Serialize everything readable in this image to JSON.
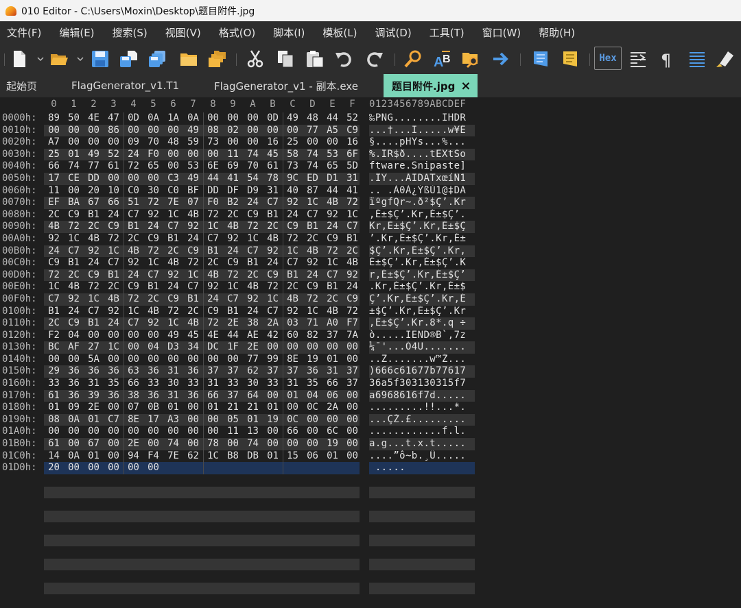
{
  "window": {
    "title": "010 Editor - C:\\Users\\Moxin\\Desktop\\题目附件.jpg"
  },
  "menu": [
    "文件(F)",
    "编辑(E)",
    "搜索(S)",
    "视图(V)",
    "格式(O)",
    "脚本(I)",
    "模板(L)",
    "调试(D)",
    "工具(T)",
    "窗口(W)",
    "帮助(H)"
  ],
  "toolbar": {
    "hex_label": "Hex",
    "colors": {
      "blue": "#4f9be8",
      "orange": "#f3a73a",
      "gray": "#d9d9d9",
      "yellow": "#f0c040"
    }
  },
  "tabs": [
    {
      "label": "起始页"
    },
    {
      "label": "FlagGenerator_v1.T1"
    },
    {
      "label": "FlagGenerator_v1 - 副本.exe"
    },
    {
      "label": "题目附件.jpg",
      "close": "×",
      "active": true
    }
  ],
  "hex_view": {
    "column_headers": [
      "0",
      "1",
      "2",
      "3",
      "4",
      "5",
      "6",
      "7",
      "8",
      "9",
      "A",
      "B",
      "C",
      "D",
      "E",
      "F"
    ],
    "ascii_header": "0123456789ABCDEF",
    "rows": [
      {
        "addr": "0000h:",
        "bytes": [
          "89",
          "50",
          "4E",
          "47",
          "0D",
          "0A",
          "1A",
          "0A",
          "00",
          "00",
          "00",
          "0D",
          "49",
          "48",
          "44",
          "52"
        ],
        "ascii": "‰PNG........IHDR"
      },
      {
        "addr": "0010h:",
        "bytes": [
          "00",
          "00",
          "00",
          "86",
          "00",
          "00",
          "00",
          "49",
          "08",
          "02",
          "00",
          "00",
          "00",
          "77",
          "A5",
          "C9"
        ],
        "ascii": "...†...I.....w¥É"
      },
      {
        "addr": "0020h:",
        "bytes": [
          "A7",
          "00",
          "00",
          "00",
          "09",
          "70",
          "48",
          "59",
          "73",
          "00",
          "00",
          "16",
          "25",
          "00",
          "00",
          "16"
        ],
        "ascii": "§....pHYs...%..."
      },
      {
        "addr": "0030h:",
        "bytes": [
          "25",
          "01",
          "49",
          "52",
          "24",
          "F0",
          "00",
          "00",
          "00",
          "11",
          "74",
          "45",
          "58",
          "74",
          "53",
          "6F"
        ],
        "ascii": "%.IR$ð....tEXtSo"
      },
      {
        "addr": "0040h:",
        "bytes": [
          "66",
          "74",
          "77",
          "61",
          "72",
          "65",
          "00",
          "53",
          "6E",
          "69",
          "70",
          "61",
          "73",
          "74",
          "65",
          "5D"
        ],
        "ascii": "ftware.Snipaste]"
      },
      {
        "addr": "0050h:",
        "bytes": [
          "17",
          "CE",
          "DD",
          "00",
          "00",
          "00",
          "C3",
          "49",
          "44",
          "41",
          "54",
          "78",
          "9C",
          "ED",
          "D1",
          "31"
        ],
        "ascii": ".ÎÝ...ÃIDATxœíÑ1"
      },
      {
        "addr": "0060h:",
        "bytes": [
          "11",
          "00",
          "20",
          "10",
          "C0",
          "30",
          "C0",
          "BF",
          "DD",
          "DF",
          "D9",
          "31",
          "40",
          "87",
          "44",
          "41"
        ],
        "ascii": ".. .À0À¿ÝßÙ1@‡DA"
      },
      {
        "addr": "0070h:",
        "bytes": [
          "EF",
          "BA",
          "67",
          "66",
          "51",
          "72",
          "7E",
          "07",
          "F0",
          "B2",
          "24",
          "C7",
          "92",
          "1C",
          "4B",
          "72"
        ],
        "ascii": "ïºgfQr~.ð²$Ç’.Kr"
      },
      {
        "addr": "0080h:",
        "bytes": [
          "2C",
          "C9",
          "B1",
          "24",
          "C7",
          "92",
          "1C",
          "4B",
          "72",
          "2C",
          "C9",
          "B1",
          "24",
          "C7",
          "92",
          "1C"
        ],
        "ascii": ",É±$Ç’.Kr,É±$Ç’."
      },
      {
        "addr": "0090h:",
        "bytes": [
          "4B",
          "72",
          "2C",
          "C9",
          "B1",
          "24",
          "C7",
          "92",
          "1C",
          "4B",
          "72",
          "2C",
          "C9",
          "B1",
          "24",
          "C7"
        ],
        "ascii": "Kr,É±$Ç’.Kr,É±$Ç"
      },
      {
        "addr": "00A0h:",
        "bytes": [
          "92",
          "1C",
          "4B",
          "72",
          "2C",
          "C9",
          "B1",
          "24",
          "C7",
          "92",
          "1C",
          "4B",
          "72",
          "2C",
          "C9",
          "B1"
        ],
        "ascii": "’.Kr,É±$Ç’.Kr,É±"
      },
      {
        "addr": "00B0h:",
        "bytes": [
          "24",
          "C7",
          "92",
          "1C",
          "4B",
          "72",
          "2C",
          "C9",
          "B1",
          "24",
          "C7",
          "92",
          "1C",
          "4B",
          "72",
          "2C"
        ],
        "ascii": "$Ç’.Kr,É±$Ç’.Kr,"
      },
      {
        "addr": "00C0h:",
        "bytes": [
          "C9",
          "B1",
          "24",
          "C7",
          "92",
          "1C",
          "4B",
          "72",
          "2C",
          "C9",
          "B1",
          "24",
          "C7",
          "92",
          "1C",
          "4B"
        ],
        "ascii": "É±$Ç’.Kr,É±$Ç’.K"
      },
      {
        "addr": "00D0h:",
        "bytes": [
          "72",
          "2C",
          "C9",
          "B1",
          "24",
          "C7",
          "92",
          "1C",
          "4B",
          "72",
          "2C",
          "C9",
          "B1",
          "24",
          "C7",
          "92"
        ],
        "ascii": "r,É±$Ç’.Kr,É±$Ç’"
      },
      {
        "addr": "00E0h:",
        "bytes": [
          "1C",
          "4B",
          "72",
          "2C",
          "C9",
          "B1",
          "24",
          "C7",
          "92",
          "1C",
          "4B",
          "72",
          "2C",
          "C9",
          "B1",
          "24"
        ],
        "ascii": ".Kr,É±$Ç’.Kr,É±$"
      },
      {
        "addr": "00F0h:",
        "bytes": [
          "C7",
          "92",
          "1C",
          "4B",
          "72",
          "2C",
          "C9",
          "B1",
          "24",
          "C7",
          "92",
          "1C",
          "4B",
          "72",
          "2C",
          "C9"
        ],
        "ascii": "Ç’.Kr,É±$Ç’.Kr,É"
      },
      {
        "addr": "0100h:",
        "bytes": [
          "B1",
          "24",
          "C7",
          "92",
          "1C",
          "4B",
          "72",
          "2C",
          "C9",
          "B1",
          "24",
          "C7",
          "92",
          "1C",
          "4B",
          "72"
        ],
        "ascii": "±$Ç’.Kr,É±$Ç’.Kr"
      },
      {
        "addr": "0110h:",
        "bytes": [
          "2C",
          "C9",
          "B1",
          "24",
          "C7",
          "92",
          "1C",
          "4B",
          "72",
          "2E",
          "38",
          "2A",
          "03",
          "71",
          "A0",
          "F7"
        ],
        "ascii": ",É±$Ç’.Kr.8*.q ÷"
      },
      {
        "addr": "0120h:",
        "bytes": [
          "F2",
          "04",
          "00",
          "00",
          "00",
          "00",
          "49",
          "45",
          "4E",
          "44",
          "AE",
          "42",
          "60",
          "82",
          "37",
          "7A"
        ],
        "ascii": "ò.....IEND®B`‚7z"
      },
      {
        "addr": "0130h:",
        "bytes": [
          "BC",
          "AF",
          "27",
          "1C",
          "00",
          "04",
          "D3",
          "34",
          "DC",
          "1F",
          "2E",
          "00",
          "00",
          "00",
          "00",
          "00"
        ],
        "ascii": "¼¯'...Ó4Ü......."
      },
      {
        "addr": "0140h:",
        "bytes": [
          "00",
          "00",
          "5A",
          "00",
          "00",
          "00",
          "00",
          "00",
          "00",
          "00",
          "77",
          "99",
          "8E",
          "19",
          "01",
          "00"
        ],
        "ascii": "..Z.......w™Ž..."
      },
      {
        "addr": "0150h:",
        "bytes": [
          "29",
          "36",
          "36",
          "36",
          "63",
          "36",
          "31",
          "36",
          "37",
          "37",
          "62",
          "37",
          "37",
          "36",
          "31",
          "37"
        ],
        "ascii": ")666c61677b77617"
      },
      {
        "addr": "0160h:",
        "bytes": [
          "33",
          "36",
          "31",
          "35",
          "66",
          "33",
          "30",
          "33",
          "31",
          "33",
          "30",
          "33",
          "31",
          "35",
          "66",
          "37"
        ],
        "ascii": "36a5f303130315f7"
      },
      {
        "addr": "0170h:",
        "bytes": [
          "61",
          "36",
          "39",
          "36",
          "38",
          "36",
          "31",
          "36",
          "66",
          "37",
          "64",
          "00",
          "01",
          "04",
          "06",
          "00"
        ],
        "ascii": "a6968616f7d....."
      },
      {
        "addr": "0180h:",
        "bytes": [
          "01",
          "09",
          "2E",
          "00",
          "07",
          "0B",
          "01",
          "00",
          "01",
          "21",
          "21",
          "01",
          "00",
          "0C",
          "2A",
          "00"
        ],
        "ascii": ".........!!...*."
      },
      {
        "addr": "0190h:",
        "bytes": [
          "08",
          "0A",
          "01",
          "C7",
          "8E",
          "17",
          "A3",
          "00",
          "00",
          "05",
          "01",
          "19",
          "0C",
          "00",
          "00",
          "00"
        ],
        "ascii": "...ÇŽ.£........."
      },
      {
        "addr": "01A0h:",
        "bytes": [
          "00",
          "00",
          "00",
          "00",
          "00",
          "00",
          "00",
          "00",
          "00",
          "11",
          "13",
          "00",
          "66",
          "00",
          "6C",
          "00"
        ],
        "ascii": "............f.l."
      },
      {
        "addr": "01B0h:",
        "bytes": [
          "61",
          "00",
          "67",
          "00",
          "2E",
          "00",
          "74",
          "00",
          "78",
          "00",
          "74",
          "00",
          "00",
          "00",
          "19",
          "00"
        ],
        "ascii": "a.g...t.x.t....."
      },
      {
        "addr": "01C0h:",
        "bytes": [
          "14",
          "0A",
          "01",
          "00",
          "94",
          "F4",
          "7E",
          "62",
          "1C",
          "B8",
          "DB",
          "01",
          "15",
          "06",
          "01",
          "00"
        ],
        "ascii": "....”ô~b.¸Û....."
      },
      {
        "addr": "01D0h:",
        "bytes": [
          "20",
          "00",
          "00",
          "00",
          "00",
          "00"
        ],
        "ascii": " ....."
      }
    ]
  }
}
